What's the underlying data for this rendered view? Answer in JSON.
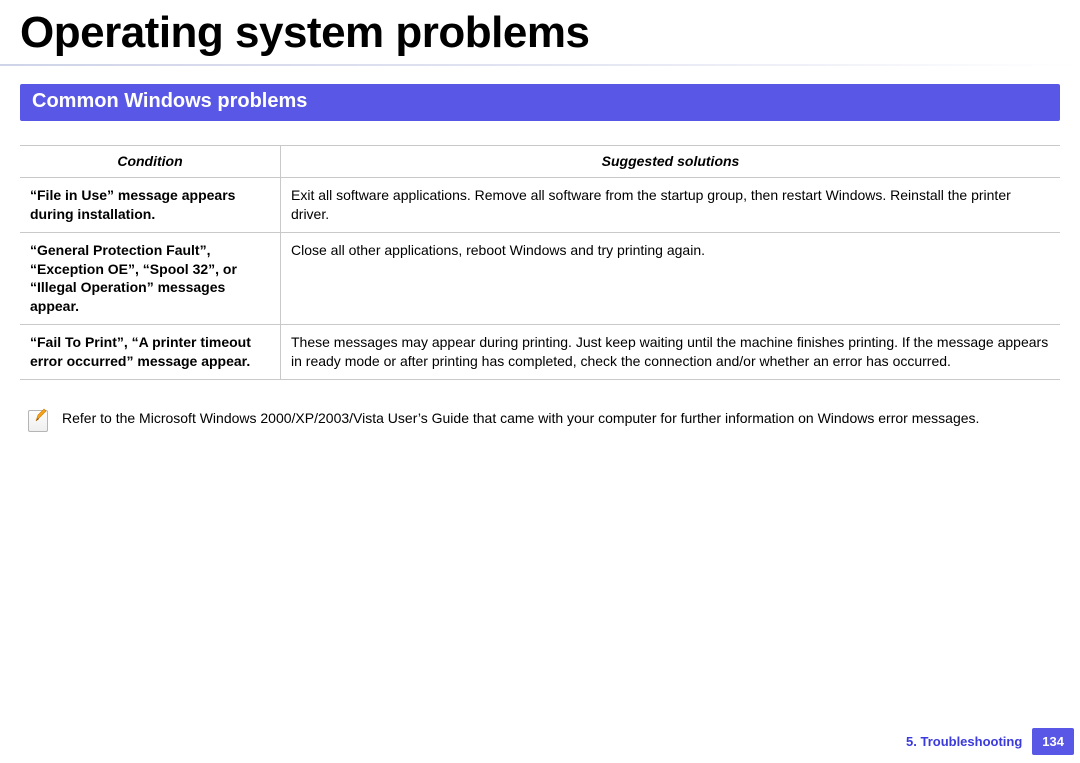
{
  "title": "Operating system problems",
  "section_heading": "Common Windows problems",
  "table": {
    "headers": {
      "condition": "Condition",
      "solutions": "Suggested solutions"
    },
    "rows": [
      {
        "condition": "“File in Use” message appears during installation.",
        "solution": "Exit all software applications. Remove all software from the startup group, then restart Windows. Reinstall the printer driver."
      },
      {
        "condition": "“General Protection Fault”, “Exception OE”, “Spool 32”, or “Illegal Operation” messages appear.",
        "solution": "Close all other applications, reboot Windows and try printing again."
      },
      {
        "condition": "“Fail To Print”, “A printer timeout error occurred” message appear.",
        "solution": "These messages may appear during printing. Just keep waiting until the machine finishes printing. If the message appears in ready mode or after printing has completed, check the connection and/or whether an error has occurred."
      }
    ]
  },
  "note": "Refer to the Microsoft Windows 2000/XP/2003/Vista User’s Guide that came with your computer for further information on Windows error messages.",
  "footer": {
    "chapter": "5.  Troubleshooting",
    "page": "134"
  }
}
